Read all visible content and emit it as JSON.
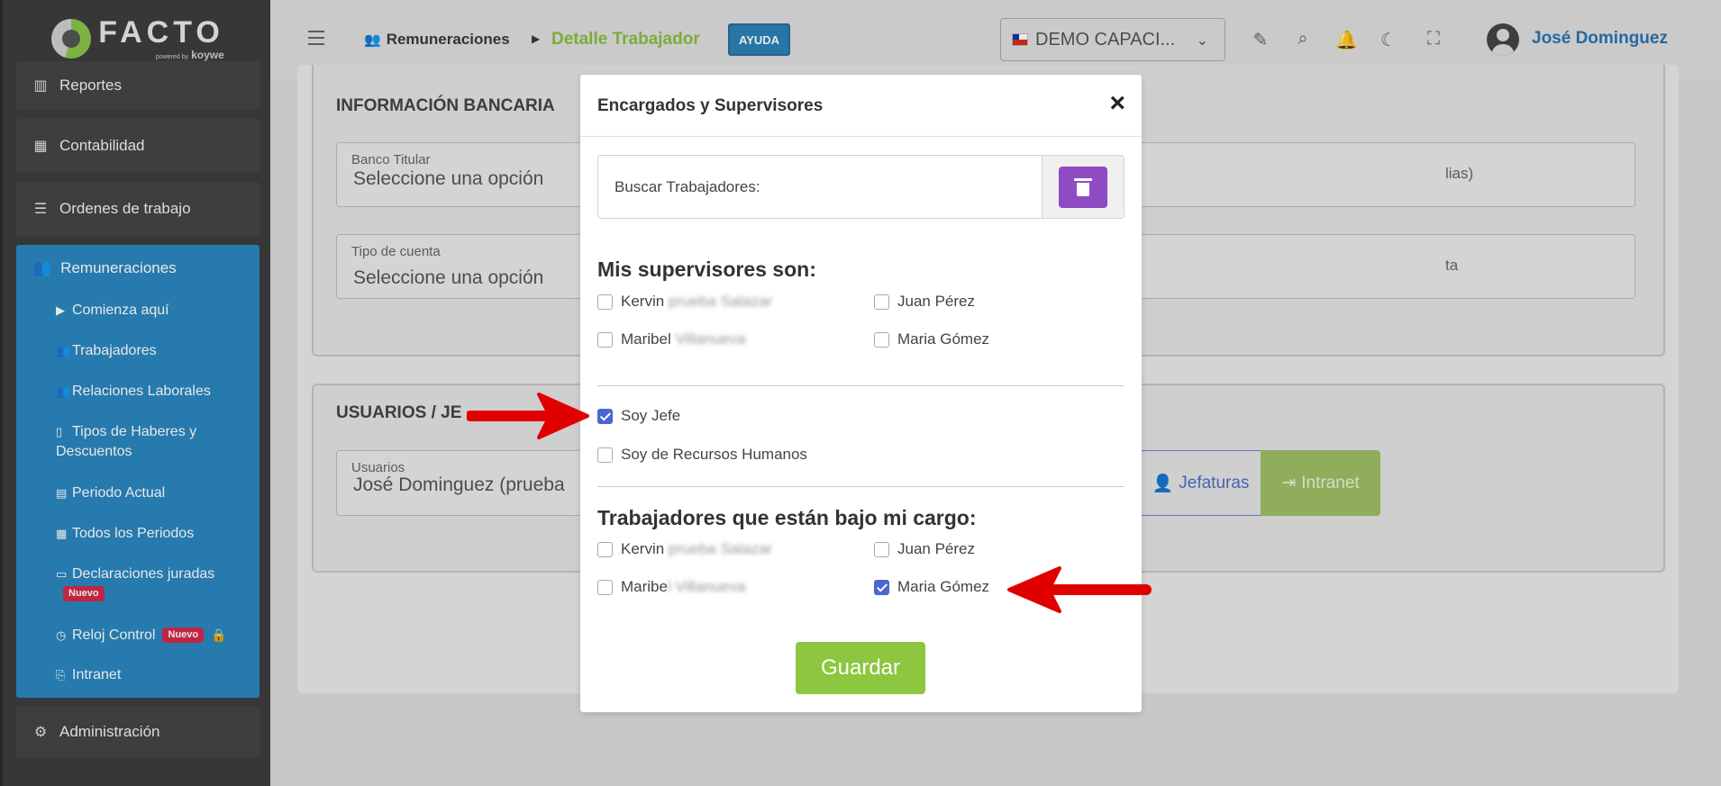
{
  "brand": {
    "name": "FACTO",
    "powered_by": "powered by",
    "vendor": "koywe",
    "accent": "#8cbc3f"
  },
  "sidebar": {
    "items": [
      {
        "label": "Reportes",
        "icon": "bar-chart-icon"
      },
      {
        "label": "Contabilidad",
        "icon": "calculator-icon"
      },
      {
        "label": "Ordenes de trabajo",
        "icon": "task-list-icon"
      }
    ],
    "group": {
      "label": "Remuneraciones",
      "icon": "users-icon",
      "items": [
        {
          "label": "Comienza aquí",
          "icon": "play-icon"
        },
        {
          "label": "Trabajadores",
          "icon": "users-gear-icon"
        },
        {
          "label": "Relaciones Laborales",
          "icon": "users-icon"
        },
        {
          "label": "Tipos de Haberes y Descuentos",
          "icon": "file-icon"
        },
        {
          "label": "Periodo Actual",
          "icon": "calendar-icon"
        },
        {
          "label": "Todos los Periodos",
          "icon": "calendar-grid-icon"
        },
        {
          "label": "Declaraciones juradas",
          "icon": "archive-icon",
          "badge": "Nuevo"
        },
        {
          "label": "Reloj Control",
          "icon": "clock-icon",
          "badge": "Nuevo",
          "locked": true
        },
        {
          "label": "Intranet",
          "icon": "intranet-icon"
        }
      ]
    },
    "admin": {
      "label": "Administración",
      "icon": "gears-icon"
    }
  },
  "topbar": {
    "breadcrumb_parent": "Remuneraciones",
    "breadcrumb_current": "Detalle Trabajador",
    "help_label": "AYUDA",
    "company": "DEMO CAPACI...",
    "user_name": "José Dominguez"
  },
  "background": {
    "bank_section_title": "INFORMACIÓN BANCARIA",
    "bank_holder_label": "Banco Titular",
    "bank_holder_value": "Seleccione una opción",
    "account_type_label": "Tipo de cuenta",
    "account_type_value": "Seleccione una opción",
    "right_field_1": "lias)",
    "right_field_2": "ta",
    "users_section_title": "USUARIOS / JE",
    "users_label": "Usuarios",
    "users_value": "José Dominguez (prueba",
    "jefaturas_label": "Jefaturas",
    "intranet_label": "Intranet"
  },
  "modal": {
    "title": "Encargados y Supervisores",
    "close_symbol": "×",
    "search_label": "Buscar Trabajadores:",
    "supervisors_heading": "Mis supervisores son:",
    "supervisors": [
      {
        "first": "Kervin",
        "rest": "prueba Salazar",
        "checked": false
      },
      {
        "first": "Juan Pérez",
        "rest": "",
        "checked": false
      },
      {
        "first": "Maribel",
        "rest": "Villanueva",
        "checked": false
      },
      {
        "first": "Maria Gómez",
        "rest": "",
        "checked": false
      }
    ],
    "role_boss": "Soy Jefe",
    "role_boss_checked": true,
    "role_hr": "Soy de Recursos Humanos",
    "role_hr_checked": false,
    "subordinates_heading": "Trabajadores que están bajo mi cargo:",
    "subordinates": [
      {
        "first": "Kervin",
        "rest": "prueba Salazar",
        "checked": false
      },
      {
        "first": "Juan Pérez",
        "rest": "",
        "checked": false
      },
      {
        "first": "Maribe",
        "rest": "l Villanueva",
        "checked": false
      },
      {
        "first": "Maria Gómez",
        "rest": "",
        "checked": true
      }
    ],
    "save_label": "Guardar"
  },
  "colors": {
    "sidebar_bg": "#3d3d3d",
    "sidebar_group_bg": "#2a87bf",
    "help_button": "#2a82b9",
    "trash_button": "#8e4bc2",
    "save_button": "#8dc63f",
    "checkbox_checked": "#4a67cf",
    "annotation_arrow": "#e00000",
    "badge_new": "#d6294a"
  }
}
